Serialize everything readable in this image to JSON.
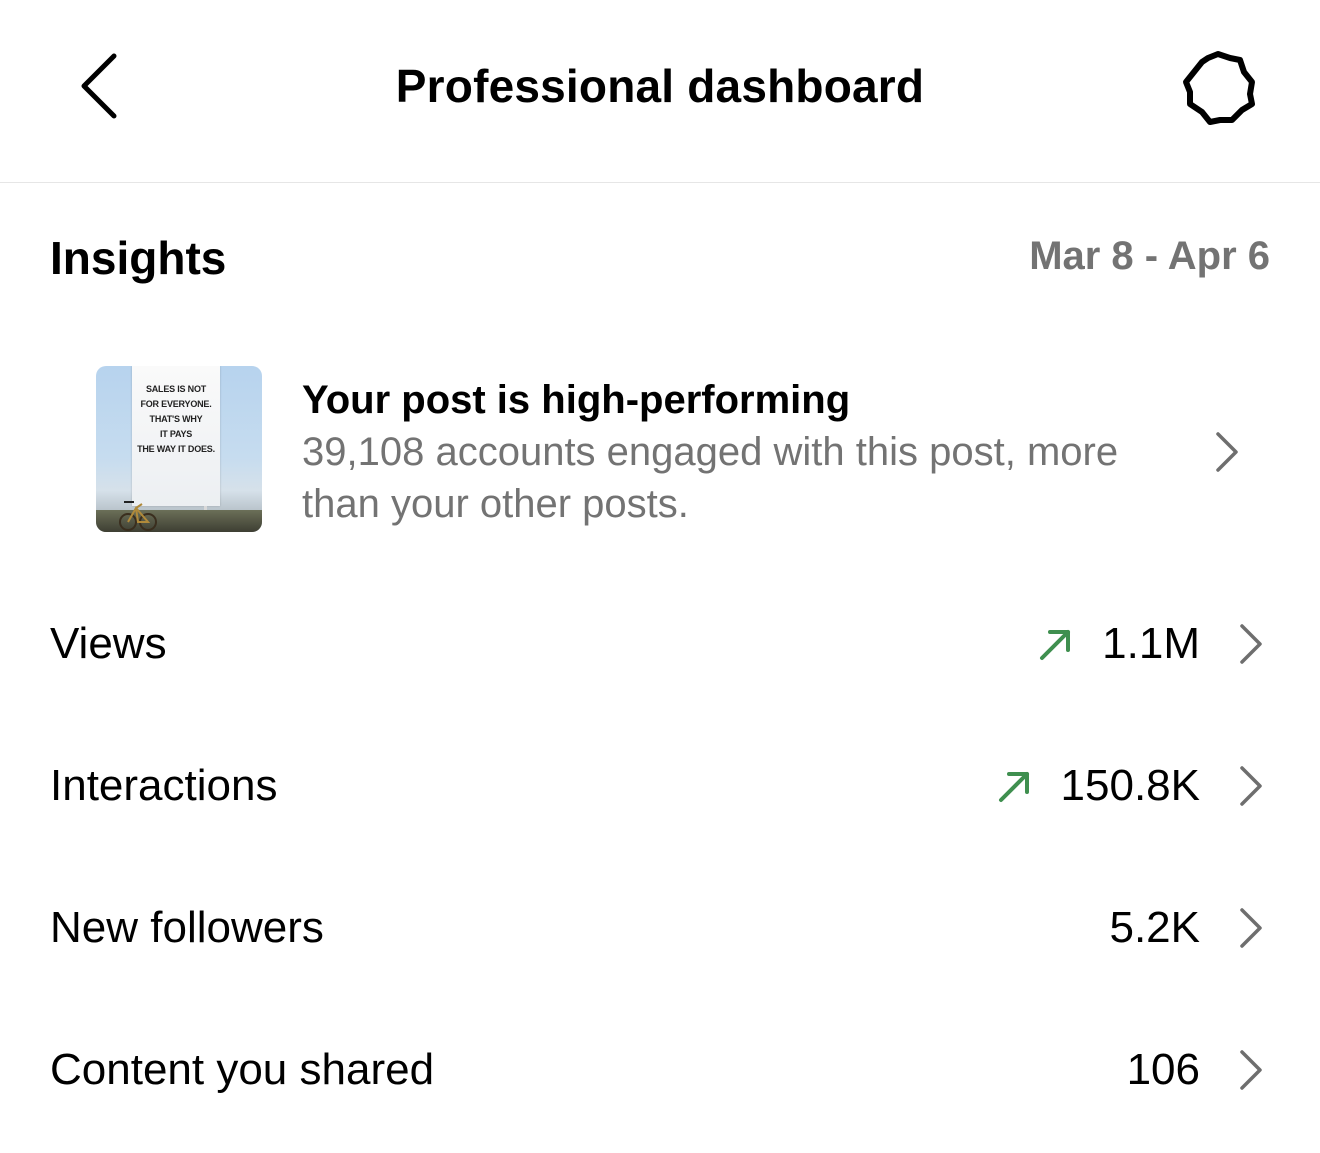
{
  "header": {
    "title": "Professional dashboard",
    "back_icon": "chevron-left-icon",
    "settings_icon": "gear-icon"
  },
  "insights": {
    "heading": "Insights",
    "date_range": "Mar 8 - Apr 6"
  },
  "highlight": {
    "title": "Your post is high-performing",
    "description": "39,108 accounts engaged with this post, more than your other posts.",
    "thumbnail_text": [
      "SALES IS NOT",
      "FOR EVERYONE.",
      "THAT'S WHY",
      "IT PAYS",
      "THE WAY IT DOES."
    ]
  },
  "metrics": [
    {
      "label": "Views",
      "value": "1.1M",
      "trend": "up"
    },
    {
      "label": "Interactions",
      "value": "150.8K",
      "trend": "up"
    },
    {
      "label": "New followers",
      "value": "5.2K",
      "trend": "none"
    },
    {
      "label": "Content you shared",
      "value": "106",
      "trend": "none"
    }
  ],
  "colors": {
    "trend_up": "#3f8f4f",
    "secondary_text": "#737373",
    "divider": "#e6e6e6",
    "chevron": "#6e6e6e"
  }
}
